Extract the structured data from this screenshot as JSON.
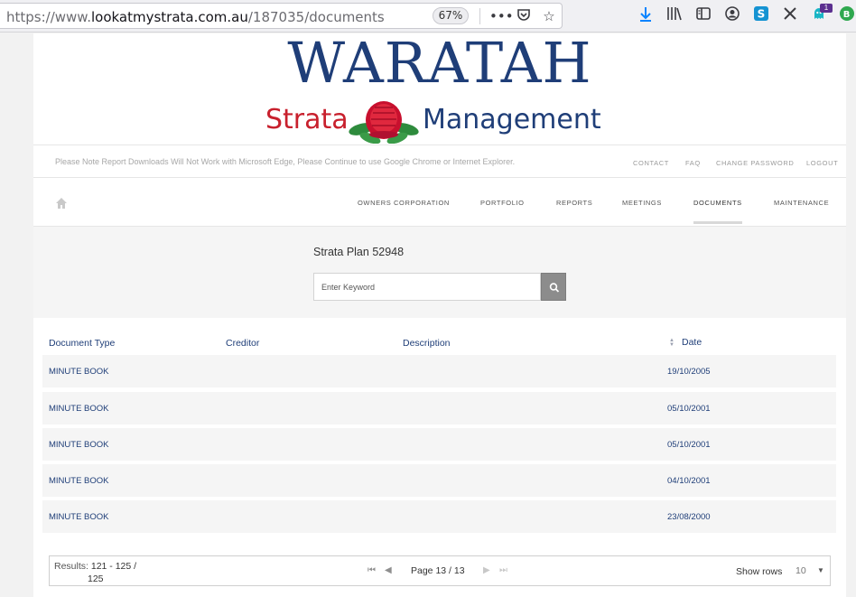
{
  "browser": {
    "url_prefix": "https://www.",
    "url_host": "lookatmystrata.com.au",
    "url_path": "/187035/documents",
    "zoom": "67%",
    "extension_badge": "1"
  },
  "logo": {
    "top_text": "WARATAH",
    "left_text": "Strata",
    "right_text": "Management"
  },
  "notice": "Please Note Report Downloads Will Not Work with Microsoft Edge, Please Continue to use Google Chrome or Internet Explorer.",
  "top_links": [
    "CONTACT",
    "FAQ",
    "CHANGE PASSWORD",
    "LOGOUT"
  ],
  "nav": {
    "items": [
      "OWNERS CORPORATION",
      "PORTFOLIO",
      "REPORTS",
      "MEETINGS",
      "DOCUMENTS",
      "MAINTENANCE"
    ],
    "active": "DOCUMENTS"
  },
  "search": {
    "title": "Strata Plan 52948",
    "placeholder": "Enter Keyword"
  },
  "table": {
    "columns": [
      "Document Type",
      "Creditor",
      "Description",
      "Date"
    ],
    "rows": [
      {
        "type": "MINUTE BOOK",
        "creditor": "",
        "description": "",
        "date": "19/10/2005"
      },
      {
        "type": "MINUTE BOOK",
        "creditor": "",
        "description": "",
        "date": "05/10/2001"
      },
      {
        "type": "MINUTE BOOK",
        "creditor": "",
        "description": "",
        "date": "05/10/2001"
      },
      {
        "type": "MINUTE BOOK",
        "creditor": "",
        "description": "",
        "date": "04/10/2001"
      },
      {
        "type": "MINUTE BOOK",
        "creditor": "",
        "description": "",
        "date": "23/08/2000"
      }
    ]
  },
  "pager": {
    "results_label": "Results:",
    "results_range": "121 - 125 /",
    "results_total": "125",
    "page_label": "Page",
    "page_value": "13 / 13",
    "show_rows_label": "Show rows",
    "rows_value": "10"
  }
}
